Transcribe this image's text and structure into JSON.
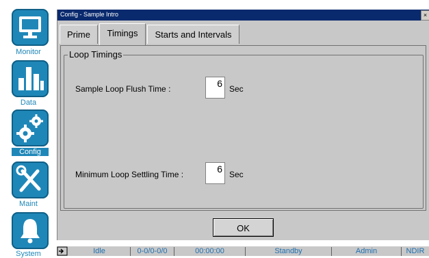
{
  "sidebar": {
    "items": [
      {
        "label": "Monitor",
        "icon": "monitor-icon"
      },
      {
        "label": "Data",
        "icon": "bar-chart-icon"
      },
      {
        "label": "Config",
        "icon": "gears-icon"
      },
      {
        "label": "Maint",
        "icon": "tools-icon"
      },
      {
        "label": "System",
        "icon": "bell-icon"
      }
    ],
    "active": "Config"
  },
  "dialog": {
    "title": "Config - Sample Intro",
    "close_label": "×",
    "tabs": [
      {
        "label": "Prime"
      },
      {
        "label": "Timings"
      },
      {
        "label": "Starts and Intervals"
      }
    ],
    "active_tab": "Timings",
    "group_label": "Loop Timings",
    "fields": [
      {
        "label": "Sample Loop Flush Time :",
        "value": "6",
        "unit": "Sec"
      },
      {
        "label": "Minimum Loop Settling Time :",
        "value": "6",
        "unit": "Sec"
      }
    ],
    "ok_label": "OK"
  },
  "statusbar": {
    "cells": [
      "Idle",
      "0-0/0-0/0",
      "00:00:00",
      "Standby",
      "Admin",
      "NDIR"
    ]
  },
  "colors": {
    "accent": "#1f87b8",
    "titlebar": "#0a2a6e",
    "dialog_bg": "#c8c8c8"
  }
}
